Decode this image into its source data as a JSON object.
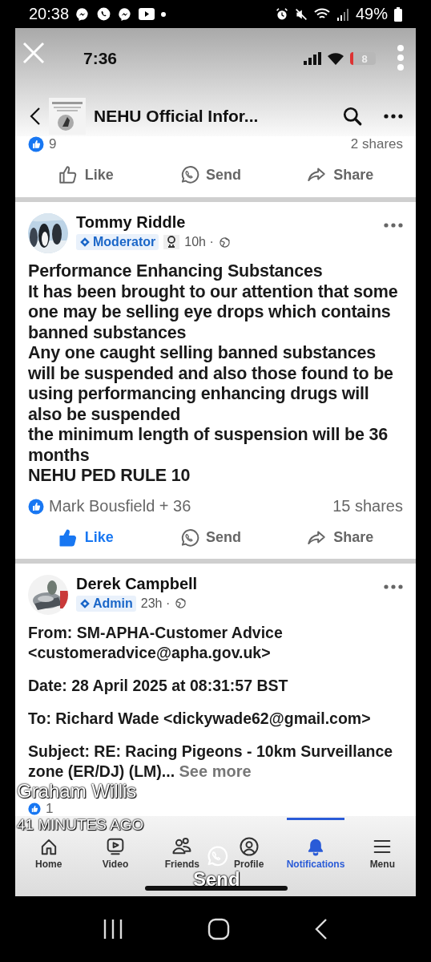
{
  "phone_status": {
    "time": "20:38",
    "battery": "49%"
  },
  "story": {
    "author": "Graham Willis",
    "age": "41 MINUTES AGO",
    "reply_label": "Send"
  },
  "screenshot": {
    "status": {
      "time": "7:36",
      "battery": "8"
    },
    "header": {
      "title": "NEHU Official Infor..."
    },
    "posts": [
      {
        "kind": "tail",
        "reactions": "9",
        "shares": "2 shares",
        "liked": false,
        "actions": [
          {
            "kind": "like",
            "label": "Like"
          },
          {
            "kind": "send",
            "label": "Send"
          },
          {
            "kind": "share",
            "label": "Share"
          }
        ]
      },
      {
        "kind": "full",
        "author": "Tommy Riddle",
        "role": "Moderator",
        "time": "10h ·",
        "body": "Performance Enhancing Substances\nIt has  been brought to our attention that some one may be selling eye drops which contains banned substances\nAny one caught selling banned substances will be suspended and also those found to be using performancing enhancing drugs will also be suspended\nthe minimum length  of suspension will be 36 months\nNEHU PED RULE 10",
        "reactions": "Mark Bousfield + 36",
        "shares": "15 shares",
        "liked": true,
        "actions": [
          {
            "kind": "like",
            "label": "Like"
          },
          {
            "kind": "send",
            "label": "Send"
          },
          {
            "kind": "share",
            "label": "Share"
          }
        ]
      },
      {
        "kind": "full",
        "author": "Derek Campbell",
        "role": "Admin",
        "time": "23h ·",
        "paragraphs": [
          "From: SM-APHA-Customer Advice <customeradvice@apha.gov.uk>",
          "Date: 28 April 2025 at 08:31:57 BST",
          "To: Richard Wade <dickywade62@gmail.com>",
          "Subject: RE: Racing Pigeons - 10km Surveillance zone (ER/DJ) (LM)..."
        ],
        "more_link": "See more",
        "reactions": "1"
      }
    ],
    "tabs": [
      {
        "kind": "home",
        "label": "Home",
        "selected": false
      },
      {
        "kind": "video",
        "label": "Video",
        "selected": false
      },
      {
        "kind": "friends",
        "label": "Friends",
        "selected": false
      },
      {
        "kind": "profile",
        "label": "Profile",
        "selected": false
      },
      {
        "kind": "bell",
        "label": "Notifications",
        "selected": true
      },
      {
        "kind": "menu",
        "label": "Menu",
        "selected": false
      }
    ]
  }
}
